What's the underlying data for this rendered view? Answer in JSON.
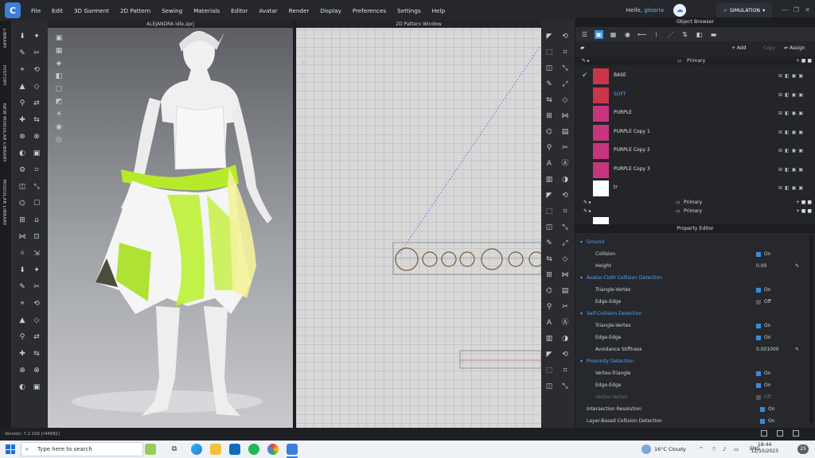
{
  "app": {
    "logo_letter": "C",
    "menu": [
      "File",
      "Edit",
      "3D Garment",
      "2D Pattern",
      "Sewing",
      "Materials",
      "Editor",
      "Avatar",
      "Render",
      "Display",
      "Preferences",
      "Settings",
      "Help"
    ],
    "hello_prefix": "Hello,",
    "username": "glooria",
    "mode_button": "SIMULATION",
    "window_controls": [
      "—",
      "❐",
      "✕"
    ]
  },
  "side_tabs": [
    "LIBRARY",
    "HISTORY",
    "NEW MODULAR LIBRARY",
    "MODULAR LIBRARY"
  ],
  "viewport3d": {
    "title": "ALEJANDRA idle.zprj"
  },
  "pattern2d": {
    "title": "2D Pattern Window"
  },
  "object_browser": {
    "title": "Object Browser",
    "add_label": "+ Add",
    "copy_label": "Copy",
    "assign_label": "Assign",
    "primary_label": "Primary",
    "fabrics": [
      {
        "name": "BASE",
        "color": "#c9364b",
        "checked": true,
        "active": false
      },
      {
        "name": "SOFT",
        "color": "#c9364b",
        "checked": false,
        "active": true
      },
      {
        "name": "PURPLE",
        "color": "#c7357f",
        "checked": false,
        "active": false
      },
      {
        "name": "PURPLE Copy 1",
        "color": "#c7357f",
        "checked": false,
        "active": false
      },
      {
        "name": "PURPLE Copy 2",
        "color": "#c7357f",
        "checked": false,
        "active": false
      },
      {
        "name": "PURPLE Copy 3",
        "color": "#c7357f",
        "checked": false,
        "active": false
      },
      {
        "name": "tr",
        "color": "#ffffff",
        "checked": false,
        "active": false
      }
    ],
    "extra_primary_1": "Primary",
    "extra_primary_2": "Primary"
  },
  "property_editor": {
    "title": "Property Editor",
    "rows": [
      {
        "type": "section",
        "label": "Ground"
      },
      {
        "type": "prop",
        "label": "Collision",
        "value": "On",
        "checked": true
      },
      {
        "type": "prop",
        "label": "Height",
        "value": "0.00"
      },
      {
        "type": "section",
        "label": "Avatar-Cloth Collision Detection"
      },
      {
        "type": "prop",
        "label": "Triangle-Vertex",
        "value": "On",
        "checked": true
      },
      {
        "type": "prop",
        "label": "Edge-Edge",
        "value": "Off",
        "checked": false
      },
      {
        "type": "section",
        "label": "Self-Collision Detection"
      },
      {
        "type": "prop",
        "label": "Triangle-Vertex",
        "value": "On",
        "checked": true
      },
      {
        "type": "prop",
        "label": "Edge-Edge",
        "value": "On",
        "checked": true
      },
      {
        "type": "prop",
        "label": "Avoidance Stiffness",
        "value": "0.001000"
      },
      {
        "type": "section",
        "label": "Proximity Detection"
      },
      {
        "type": "prop",
        "label": "Vertex-Triangle",
        "value": "On",
        "checked": true
      },
      {
        "type": "prop",
        "label": "Edge-Edge",
        "value": "On",
        "checked": true
      },
      {
        "type": "prop-dim",
        "label": "Vertex-Vertex",
        "value": "Off",
        "checked": false
      },
      {
        "type": "prop-top",
        "label": "Intersection Resolution",
        "value": "On",
        "checked": true
      },
      {
        "type": "prop-top",
        "label": "Layer-Based Collision Detection",
        "value": "On",
        "checked": true
      }
    ]
  },
  "status": {
    "version": "Version: 7.2.156 (r44682)"
  },
  "taskbar": {
    "search_placeholder": "Type here to search",
    "weather": "16°C  Cloudy",
    "lang": "ENG",
    "time": "18:44",
    "date": "12/10/2023",
    "notif_count": "25"
  }
}
